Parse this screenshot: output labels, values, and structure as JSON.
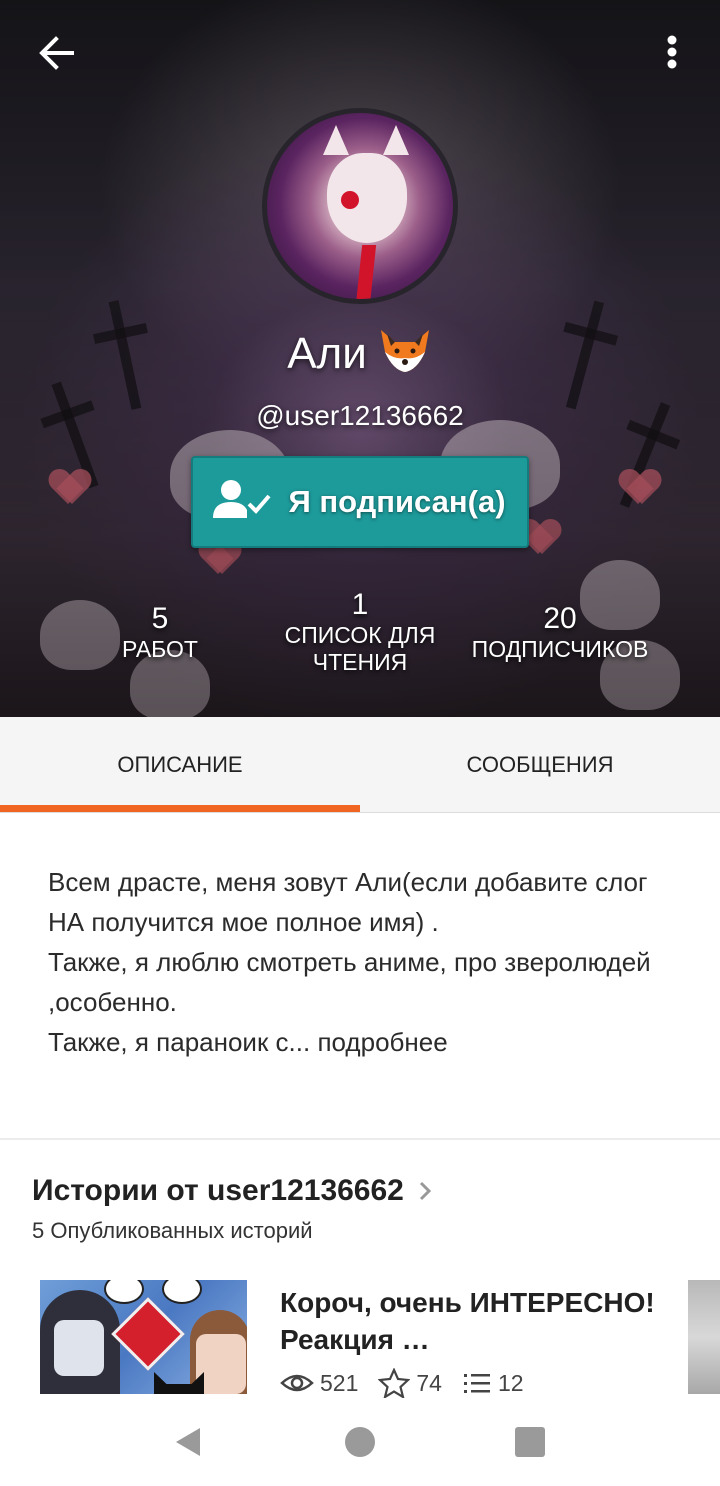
{
  "header": {
    "back_icon": "arrow-left-icon",
    "more_icon": "more-vertical-icon"
  },
  "profile": {
    "display_name": "Али",
    "name_emoji_icon": "fox-icon",
    "handle": "@user12136662",
    "follow_button_label": "Я подписан(а)",
    "follow_icon": "user-check-icon",
    "follow_button_color": "#1d9a9a"
  },
  "stats": [
    {
      "value": "5",
      "label": "РАБОТ"
    },
    {
      "value": "1",
      "label": "СПИСОК ДЛЯ ЧТЕНИЯ"
    },
    {
      "value": "20",
      "label": "ПОДПИСЧИКОВ"
    }
  ],
  "tabs": [
    {
      "label": "ОПИСАНИЕ",
      "active": true
    },
    {
      "label": "СООБЩЕНИЯ",
      "active": false
    }
  ],
  "accent_color": "#f06522",
  "description": {
    "text": "Всем драсте, меня зовут Али(если добавите слог НА получится мое полное имя) .\nТакже, я люблю смотреть аниме, про зверолюдей ,особенно.\nТакже, я параноик с...",
    "more_label": "подробнее"
  },
  "stories": {
    "title": "Истории от user12136662",
    "subtitle": "5 Опубликованных историй",
    "items": [
      {
        "title": "Короч, очень ИНТЕРЕСНО! Реакция …",
        "views": "521",
        "votes": "74",
        "parts": "12"
      }
    ]
  },
  "system_nav": {
    "back_icon": "triangle-back-icon",
    "home_icon": "circle-home-icon",
    "recents_icon": "square-recents-icon"
  }
}
